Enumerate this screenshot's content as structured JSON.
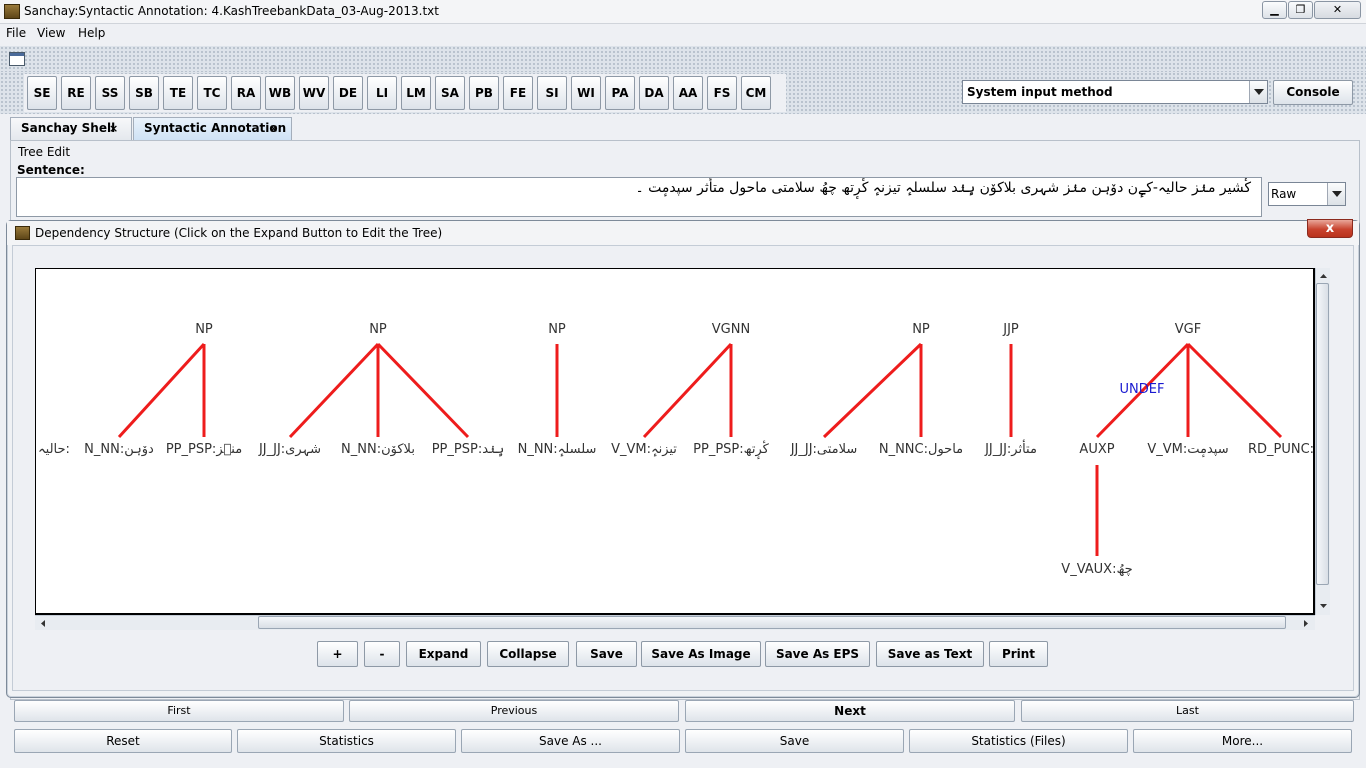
{
  "window": {
    "title": "Sanchay:Syntactic Annotation: 4.KashTreebankData_03-Aug-2013.txt",
    "minimize": "▁",
    "maximize": "❐",
    "close": "✕"
  },
  "menu": [
    "File",
    "View",
    "Help"
  ],
  "toolbar": {
    "buttons": [
      "SE",
      "RE",
      "SS",
      "SB",
      "TE",
      "TC",
      "RA",
      "WB",
      "WV",
      "DE",
      "LI",
      "LM",
      "SA",
      "PB",
      "FE",
      "SI",
      "WI",
      "PA",
      "DA",
      "AA",
      "FS",
      "CM"
    ],
    "input_method": "System input method",
    "console": "Console"
  },
  "tabs": [
    {
      "label": "Sanchay Shell",
      "close": "×"
    },
    {
      "label": "Syntactic Annotation",
      "close": "×"
    }
  ],
  "tree_edit": {
    "group_label": "Tree Edit",
    "sentence_label": "Sentence:",
    "sentence": "کٔشیر منٛز حالیہ-کےٕن دوٚہن منٛز شہری بلاکوٚن ہٕنٛد سلسلہٕ تیزنہٕ کٔرٕتھ چھُ سلامتی ماحول متأثر سپدمٕت ۔",
    "mode": "Raw"
  },
  "dialog": {
    "title": "Dependency Structure (Click on the Expand Button to Edit the Tree)",
    "close": "x",
    "buttons": [
      "+",
      "-",
      "Expand",
      "Collapse",
      "Save",
      "Save As Image",
      "Save As EPS",
      "Save as Text",
      "Print"
    ]
  },
  "tree": {
    "edge_color": "#ee1c1c",
    "label_color": "#333333",
    "undef_color": "#1a1ad0",
    "undef_label": "UNDEF",
    "chunks": [
      {
        "label": "NP"
      },
      {
        "label": "NP"
      },
      {
        "label": "NP"
      },
      {
        "label": "VGNN"
      },
      {
        "label": "NP"
      },
      {
        "label": "JJP"
      },
      {
        "label": "VGF"
      }
    ],
    "leaves": [
      "حالیہ:",
      "N_NN:دوٚہن",
      "PP_PSP:منٛز",
      "JJ_JJ:شہری",
      "N_NN:بلاکوٚن",
      "PP_PSP:ہٕنٛد",
      "N_NN:سلسلہٕ",
      "V_VM:تیزنہٕ",
      "PP_PSP:کٔرٕتھ",
      "JJ_JJ:سلامتی",
      "N_NNC:ماحول",
      "JJ_JJ:متأثر",
      "AUXP",
      "V_VM:سپدمٕت",
      "RD_PUNC:"
    ],
    "aux_child": "V_VAUX:چھُ"
  },
  "nav": {
    "row1": [
      "First",
      "Previous",
      "Next",
      "Last"
    ],
    "row2": [
      "Reset",
      "Statistics",
      "Save As ...",
      "Save",
      "Statistics (Files)",
      "More..."
    ]
  }
}
